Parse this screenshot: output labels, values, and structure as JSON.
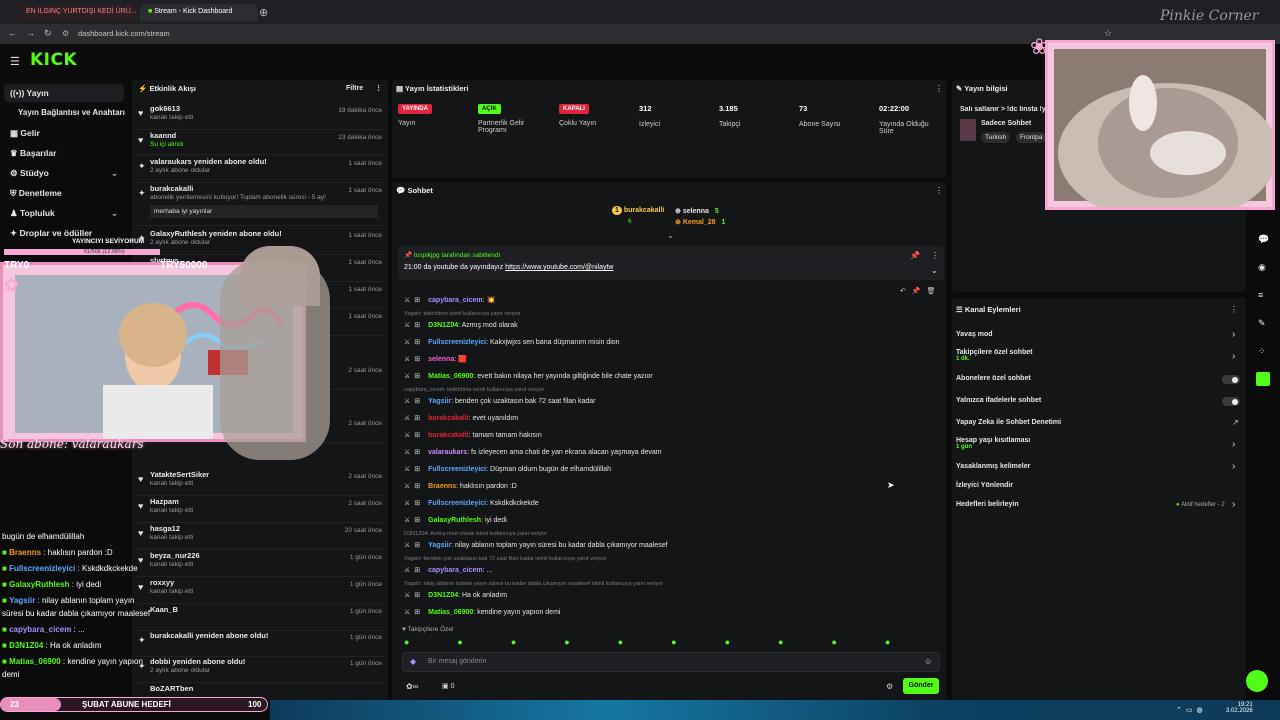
{
  "browser": {
    "tabs": [
      {
        "label": "EN İLGİNÇ YURTDIŞI KEDİ ÜRÜ..."
      },
      {
        "label": "Stream - Kick Dashboard"
      }
    ],
    "url": "dashboard.kick.com/stream",
    "brand": "KICK",
    "overlay_cursive": "Pinkie Corner"
  },
  "sidebar": {
    "items": [
      {
        "label": "Yayın"
      },
      {
        "label": "Yayın Bağlantısı ve Anahtarı"
      },
      {
        "label": "Gelir"
      },
      {
        "label": "Başarılar"
      },
      {
        "label": "Stüdyo"
      },
      {
        "label": "Denetleme"
      },
      {
        "label": "Topluluk"
      },
      {
        "label": "Droplar ve ödüller"
      }
    ]
  },
  "activity": {
    "title": "Etkinlik Akışı",
    "filter": "Filtre",
    "items": [
      {
        "name": "gok6613",
        "sub": "kanalı takip etti",
        "time": "19 dakika önce"
      },
      {
        "name": "kaannd",
        "sub": "Su içi alındı",
        "time": "23 dakika önce"
      },
      {
        "name": "valaraukars yeniden abone oldu!",
        "sub": "2 aylık abone oldular",
        "time": "1 saat önce"
      },
      {
        "name": "burakcakalli",
        "sub": "abonelik yenilemesini kutluyor! Toplam abonelik süresi - 5 ay!",
        "time": "1 saat önce",
        "msg": "merhaba iyi yayınlar"
      },
      {
        "name": "GalaxyRuthlesh yeniden abone oldu!",
        "sub": "2 aylık abone oldular",
        "time": "1 saat önce"
      },
      {
        "name": "slyrtnys",
        "sub": "",
        "time": "1 saat önce"
      },
      {
        "name": "YatakteSertSiker",
        "sub": "kanalı takip etti",
        "time": "2 saat önce"
      },
      {
        "name": "Hazpam",
        "sub": "kanalı takip etti",
        "time": "2 saat önce"
      },
      {
        "name": "hasga12",
        "sub": "kanalı takip etti",
        "time": "20 saat önce"
      },
      {
        "name": "beyza_nur226",
        "sub": "kanalı takip etti",
        "time": "1 gün önce"
      },
      {
        "name": "roxxyy",
        "sub": "kanalı takip etti",
        "time": "1 gün önce"
      },
      {
        "name": "Kaan_B",
        "sub": "",
        "time": "1 gün önce"
      },
      {
        "name": "burakcakalli yeniden abone oldu!",
        "sub": "",
        "time": "1 gün önce"
      },
      {
        "name": "dobbi yeniden abone oldu!",
        "sub": "2 aylık abone oldular",
        "time": "1 gün önce"
      },
      {
        "name": "BoZARTben",
        "sub": "",
        "time": ""
      }
    ],
    "extra_times": [
      "1 saat önce",
      "1 saat önce",
      "2 saat önce",
      "2 saat önce"
    ]
  },
  "stats": {
    "title": "Yayın İstatistikleri",
    "cols": [
      {
        "badge": "YAYINDA",
        "label": "Yayın"
      },
      {
        "badge": "AÇIK",
        "label": "Partnerlik Gelir Programı"
      },
      {
        "badge": "KAPALI",
        "label": "Çoklu Yayın"
      },
      {
        "value": "312",
        "label": "İzleyici"
      },
      {
        "value": "3.185",
        "label": "Takipçi"
      },
      {
        "value": "73",
        "label": "Abone Sayısı"
      },
      {
        "value": "02:22:00",
        "label": "Yayında Olduğu Süre"
      }
    ]
  },
  "info": {
    "title": "Yayın bilgisi",
    "stream_title": "Salı sallanır > !dc linsta !y",
    "category": "Sadece Sohbet",
    "tags": [
      "Turkish",
      "Frontpa"
    ]
  },
  "chat": {
    "title": "Sohbet",
    "top": [
      {
        "name": "burakcakalli",
        "n": "6"
      },
      {
        "name": "selenna",
        "n": "5"
      },
      {
        "name": "Kemal_28",
        "n": "1"
      }
    ],
    "pinned_by": "tospikjpg tarafından sabitlendi",
    "pinned_text": "21:00 da youtube da yayındayız",
    "pinned_link": "https://www.youtube.com/@nilaytw",
    "messages": [
      {
        "user": "capybara_cicem",
        "text": "",
        "color": "#a98cff",
        "emoji": "💥"
      },
      {
        "reply": "Yagsiir: twitchtime isimli kullanıcıya yanıt veriyor"
      },
      {
        "user": "D3N1Z04",
        "text": "Azmış mod olarak",
        "color": "#53fc18"
      },
      {
        "user": "Fullscreenizleyici",
        "text": "Kakxjwjxs sen bana düşmanım misin dion",
        "color": "#5aa9ff"
      },
      {
        "user": "selenna",
        "text": "",
        "color": "#ff5ad1",
        "emoji": "🟥"
      },
      {
        "user": "Matias_06900",
        "text": "evett bakın nilaya her yayında giltiğinde bile chate yazıor",
        "color": "#53fc18"
      },
      {
        "reply": "capybara_cicem: twitchtime isimli kullanıcıya yanıt veriyor"
      },
      {
        "user": "Yagsiir",
        "text": "benden çok uzaktasın bak 72 saat filan kadar",
        "color": "#5aa9ff"
      },
      {
        "user": "burakcakalli",
        "text": "evet uyanıldım",
        "color": "#e0243a"
      },
      {
        "user": "burakcakalli",
        "text": "tamam tamam hakısın",
        "color": "#e0243a"
      },
      {
        "user": "valaraukars",
        "text": "fs izleyecen ama chati de yan ekrana alacan yaşmaya devam",
        "color": "#c98cff"
      },
      {
        "user": "Fullscreenizleyici",
        "text": "Düşman oldum bugün de elhamdülillah",
        "color": "#5aa9ff"
      },
      {
        "user": "Braenns",
        "text": "haklısın pardon :D",
        "color": "#f79a1e"
      },
      {
        "user": "Fullscreenizleyici",
        "text": "Kskdkdkckekde",
        "color": "#5aa9ff"
      },
      {
        "user": "GalaxyRuthlesh",
        "text": "iyi dedi",
        "color": "#53fc18"
      },
      {
        "reply": "D3N1Z04: Azmış mod olarak isimli kullanıcıya yanıt veriyor"
      },
      {
        "user": "Yagsiir",
        "text": "nilay ablanın toplam yayın süresi bu kadar dabla çıkamıyor maalesef",
        "color": "#5aa9ff"
      },
      {
        "reply": "Yagsiir: benden çok uzaktasın bak 72 saat filan kadar isimli kullanıcıya yanıt veriyor"
      },
      {
        "user": "capybara_cicem",
        "text": "...",
        "color": "#a98cff"
      },
      {
        "reply": "Yagsiir: nilay ablanın toplam yayın süresi bu kadar dabla çıkamıyor maalesef isimli kullanıcıya yanıt veriyor"
      },
      {
        "user": "D3N1Z04",
        "text": "Ha ok anladım",
        "color": "#53fc18"
      },
      {
        "user": "Matias_06900",
        "text": "kendine yayın yapıon demi",
        "color": "#53fc18"
      }
    ],
    "followers_only": "Takipçilere Özel",
    "input_placeholder": "Bir mesaj gönderin",
    "count": "0",
    "send": "Gönder"
  },
  "channel_actions": {
    "title": "Kanal Eylemleri",
    "items": [
      {
        "label": "Yavaş mod",
        "kind": "chev"
      },
      {
        "label": "Takipçilere özel sohbet",
        "sub": "1 dk.",
        "kind": "chev"
      },
      {
        "label": "Abonelere özel sohbet",
        "kind": "toggle"
      },
      {
        "label": "Yalnızca ifadelerle sohbet",
        "kind": "toggle"
      },
      {
        "label": "Yapay Zeka ile Sohbet Denetimi",
        "kind": "ext"
      },
      {
        "label": "Hesap yaşı kısıtlaması",
        "sub": "1 gün",
        "kind": "chev"
      },
      {
        "label": "Yasaklanmış kelimeler",
        "kind": "chev"
      },
      {
        "label": "İzleyici Yönlendir",
        "kind": "none"
      },
      {
        "label": "Hedefleri belirleyin",
        "extra": "Aktif hedefler - 2",
        "kind": "chev"
      }
    ]
  },
  "overlay": {
    "loves": "YAYINCIYI SEVİYORUM",
    "loves_progress": "61/506 (12.08%)",
    "currency1": "TRY0",
    "currency2": "TRY50000",
    "last_sub": "Son abone: valaraukars",
    "chat_lines": [
      {
        "user": "",
        "text": "bugün de elhamdülillah",
        "color": "#fff"
      },
      {
        "user": "Braenns",
        "text": "haklısın pardon :D",
        "color": "#f79a1e"
      },
      {
        "user": "Fullscreenizleyici",
        "text": "Kskdkdkckekde",
        "color": "#5aa9ff"
      },
      {
        "user": "GalaxyRuthlesh",
        "text": "iyi dedi",
        "color": "#53fc18"
      },
      {
        "user": "Yagsiir",
        "text": "nilay ablanın toplam yayın",
        "color": "#5aa9ff"
      },
      {
        "user": "",
        "text": "süresi bu kadar dabla çıkamıyor maalesef",
        "color": "#fff"
      },
      {
        "user": "capybara_cicem",
        "text": "...",
        "color": "#a98cff"
      },
      {
        "user": "D3N1Z04",
        "text": "Ha ok anladım",
        "color": "#53fc18"
      },
      {
        "user": "Matias_06900",
        "text": "kendine yayın yapıon",
        "color": "#53fc18"
      },
      {
        "user": "",
        "text": "demi",
        "color": "#fff"
      }
    ],
    "goal_count": "23",
    "goal_label": "ŞUBAT ABUNE HEDEFİ",
    "goal_target": "100"
  },
  "taskbar": {
    "time": "19:21",
    "date": "3.02.2026"
  }
}
